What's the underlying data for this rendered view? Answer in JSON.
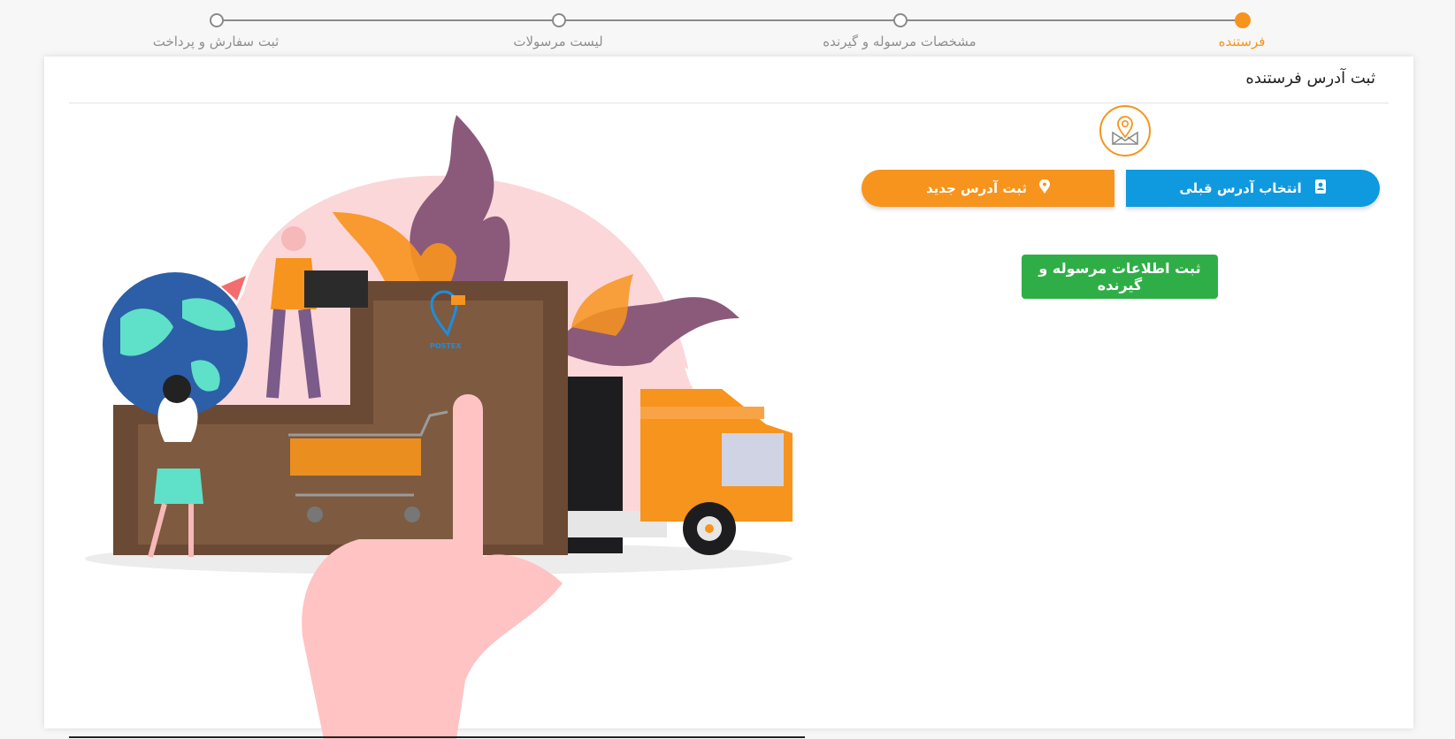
{
  "stepper": {
    "steps": [
      {
        "label": "فرستنده",
        "active": true
      },
      {
        "label": "مشخصات مرسوله و گیرنده",
        "active": false
      },
      {
        "label": "لیست مرسولات",
        "active": false
      },
      {
        "label": "ثبت سفارش و پرداخت",
        "active": false
      }
    ]
  },
  "card": {
    "title": "ثبت آدرس فرستنده"
  },
  "actions": {
    "select_previous_address": "انتخاب آدرس قبلی",
    "register_new_address": "ثبت آدرس جدید",
    "submit_parcel_info": "ثبت اطلاعات مرسوله و گیرنده"
  },
  "icons": {
    "pin": "map-pin-envelope-icon",
    "contacts": "address-book-icon",
    "location": "location-marker-icon"
  },
  "illustration": {
    "logo_text": "POSTEX"
  },
  "colors": {
    "accent": "#f7941d",
    "primary": "#0f9ae0",
    "success": "#2fae47"
  }
}
